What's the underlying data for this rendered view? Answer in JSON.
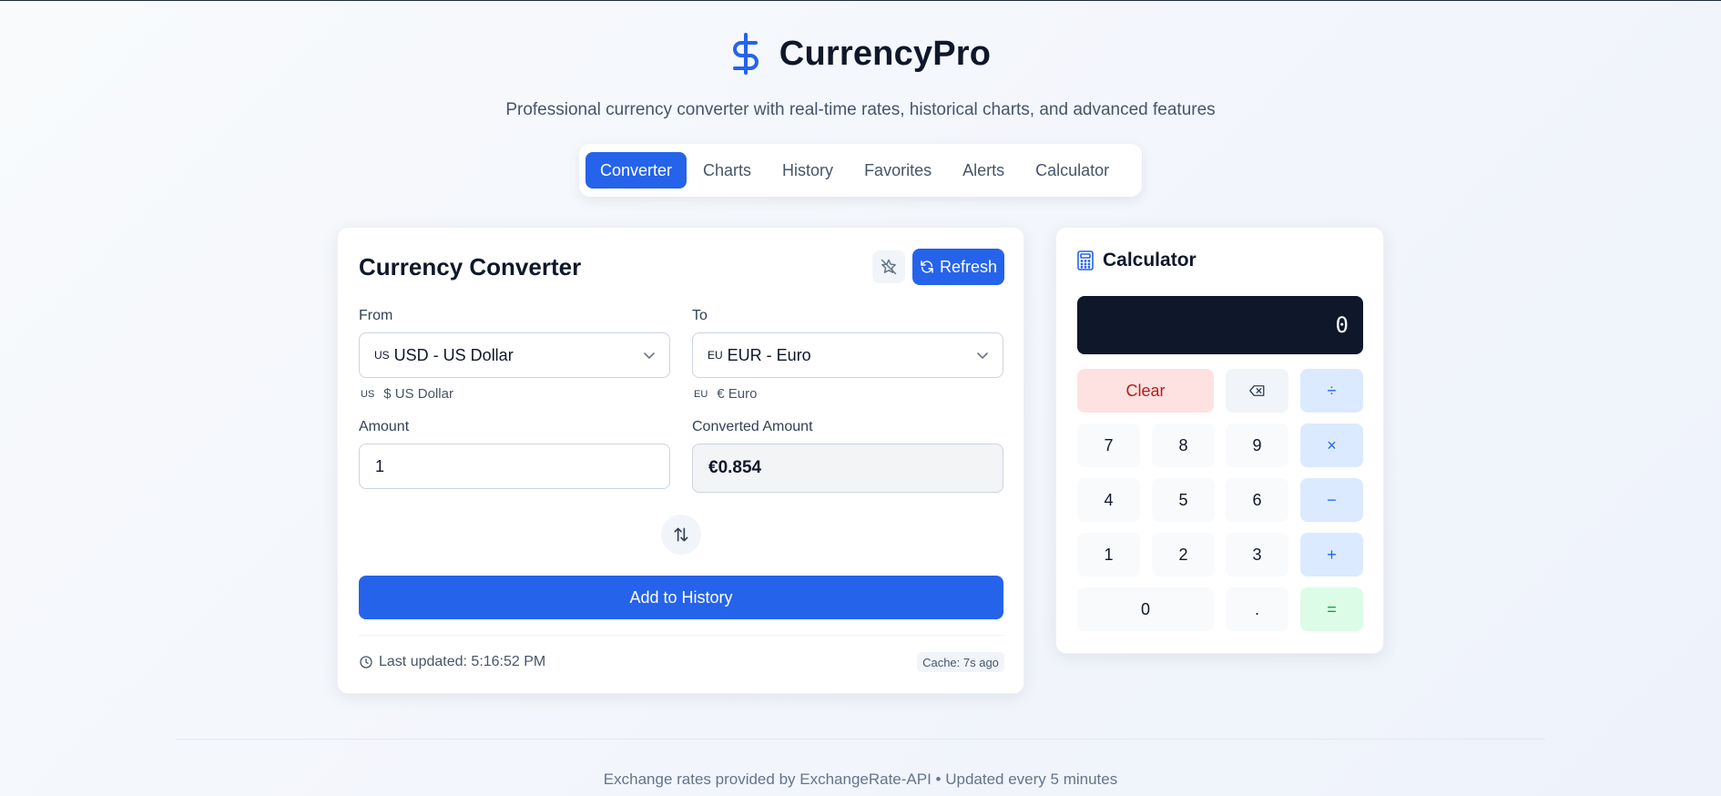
{
  "app": {
    "title": "CurrencyPro",
    "tagline": "Professional currency converter with real-time rates, historical charts, and advanced features",
    "icon": "dollar-sign-icon",
    "accent": "#2563eb"
  },
  "tabs": [
    {
      "label": "Converter",
      "active": true
    },
    {
      "label": "Charts",
      "active": false
    },
    {
      "label": "History",
      "active": false
    },
    {
      "label": "Favorites",
      "active": false
    },
    {
      "label": "Alerts",
      "active": false
    },
    {
      "label": "Calculator",
      "active": false
    }
  ],
  "converter": {
    "title": "Currency Converter",
    "favorite_icon": "star-off-icon",
    "refresh_label": "Refresh",
    "from": {
      "label": "From",
      "flag": "US",
      "value": "USD - US Dollar",
      "sub_flag": "US",
      "sub_text": "$ US Dollar"
    },
    "to": {
      "label": "To",
      "flag": "EU",
      "value": "EUR - Euro",
      "sub_flag": "EU",
      "sub_text": "€ Euro"
    },
    "amount": {
      "label": "Amount",
      "value": "1"
    },
    "converted": {
      "label": "Converted Amount",
      "value": "€0.854"
    },
    "swap_icon": "swap-arrows-icon",
    "add_history_label": "Add to History",
    "last_updated": "Last updated: 5:16:52 PM",
    "cache": "Cache: 7s ago"
  },
  "calculator": {
    "title": "Calculator",
    "display": "0",
    "keys": {
      "clear": "Clear",
      "backspace_icon": "backspace-icon",
      "divide": "÷",
      "multiply": "×",
      "minus": "−",
      "plus": "+",
      "equals": "=",
      "dot": ".",
      "k0": "0",
      "k1": "1",
      "k2": "2",
      "k3": "3",
      "k4": "4",
      "k5": "5",
      "k6": "6",
      "k7": "7",
      "k8": "8",
      "k9": "9"
    }
  },
  "footer": {
    "text": "Exchange rates provided by ExchangeRate-API • Updated every 5 minutes"
  }
}
